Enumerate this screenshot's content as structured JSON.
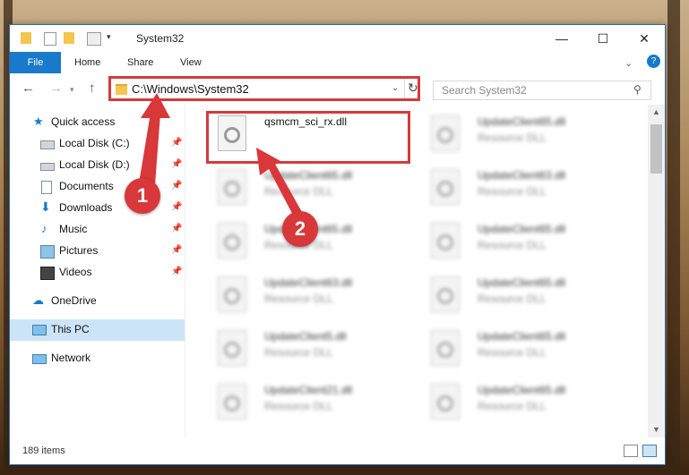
{
  "window": {
    "title": "System32",
    "controls": {
      "minimize": "—",
      "maximize": "☐",
      "close": "✕"
    }
  },
  "ribbon": {
    "file": "File",
    "home": "Home",
    "share": "Share",
    "view": "View"
  },
  "address": {
    "path": "C:\\Windows\\System32",
    "search_placeholder": "Search System32"
  },
  "sidebar": {
    "items": [
      {
        "label": "Quick access",
        "icon": "star-icon",
        "pinned": false
      },
      {
        "label": "Local Disk (C:)",
        "icon": "drive-icon",
        "pinned": true
      },
      {
        "label": "Local Disk (D:)",
        "icon": "drive-icon",
        "pinned": true
      },
      {
        "label": "Documents",
        "icon": "documents-icon",
        "pinned": true
      },
      {
        "label": "Downloads",
        "icon": "download-icon",
        "pinned": true
      },
      {
        "label": "Music",
        "icon": "music-icon",
        "pinned": true
      },
      {
        "label": "Pictures",
        "icon": "pictures-icon",
        "pinned": true
      },
      {
        "label": "Videos",
        "icon": "videos-icon",
        "pinned": true
      },
      {
        "label": "OneDrive",
        "icon": "cloud-icon",
        "pinned": false
      },
      {
        "label": "This PC",
        "icon": "computer-icon",
        "pinned": false,
        "selected": true
      },
      {
        "label": "Network",
        "icon": "network-icon",
        "pinned": false
      }
    ]
  },
  "files": [
    {
      "name": "qsmcm_sci_rx.dll",
      "type": "",
      "highlighted": true
    },
    {
      "name": "UpdateClient65.dll",
      "type": "Resource DLL"
    },
    {
      "name": "UpdateClient65.dll",
      "type": "Resource DLL"
    },
    {
      "name": "UpdateClient63.dll",
      "type": "Resource DLL"
    },
    {
      "name": "UpdateClient65.dll",
      "type": "Resource DLL"
    },
    {
      "name": "UpdateClient65.dll",
      "type": "Resource DLL"
    },
    {
      "name": "UpdateClient63.dll",
      "type": "Resource DLL"
    },
    {
      "name": "UpdateClient65.dll",
      "type": "Resource DLL"
    },
    {
      "name": "UpdateClient5.dll",
      "type": "Resource DLL"
    },
    {
      "name": "UpdateClient65.dll",
      "type": "Resource DLL"
    },
    {
      "name": "UpdateClient21.dll",
      "type": "Resource DLL"
    },
    {
      "name": "UpdateClient65.dll",
      "type": "Resource DLL"
    }
  ],
  "status": {
    "count": "189 items"
  },
  "annotations": {
    "step1": "1",
    "step2": "2"
  },
  "colors": {
    "accent": "#1979ca",
    "annotation": "#d8383a"
  }
}
